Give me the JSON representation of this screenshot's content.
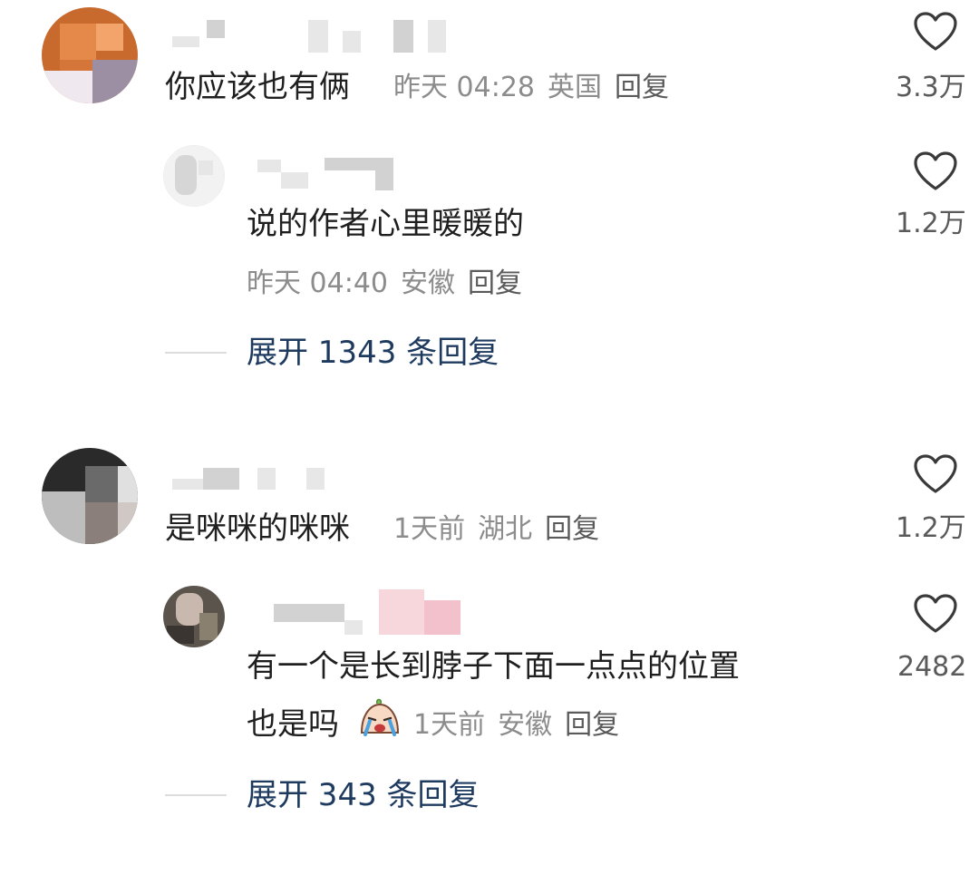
{
  "thread1": {
    "comment": {
      "text": "你应该也有俩",
      "time": "昨天 04:28",
      "location": "英国",
      "reply_label": "回复",
      "likes": "3.3万"
    },
    "reply": {
      "text": "说的作者心里暖暖的",
      "time": "昨天 04:40",
      "location": "安徽",
      "reply_label": "回复",
      "likes": "1.2万"
    },
    "expand_label": "展开 1343 条回复"
  },
  "thread2": {
    "comment": {
      "text": "是咪咪的咪咪",
      "time": "1天前",
      "location": "湖北",
      "reply_label": "回复",
      "likes": "1.2万"
    },
    "reply": {
      "text_line1": "有一个是长到脖子下面一点点的位置",
      "text_line2": "也是吗",
      "emoji": "crying-face-emoji",
      "time": "1天前",
      "location": "安徽",
      "reply_label": "回复",
      "likes": "2482"
    },
    "expand_label": "展开 343 条回复"
  },
  "icons": {
    "like": "heart-outline-icon"
  },
  "colors": {
    "text_primary": "#1f1f1f",
    "text_meta": "#8c8c8c",
    "expand_text": "#1e3a5f",
    "heart_stroke": "#3a3a3a"
  }
}
